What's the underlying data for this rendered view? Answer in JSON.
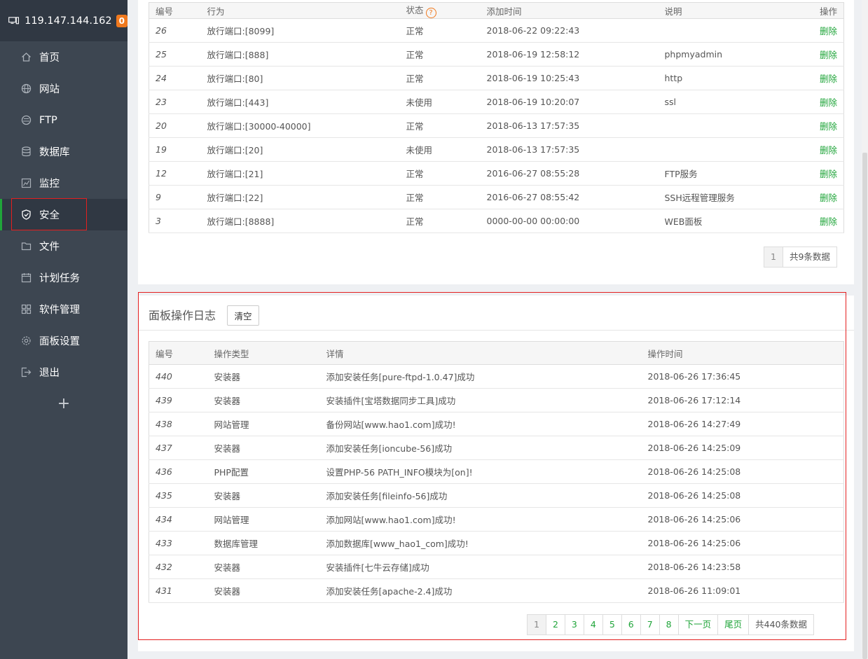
{
  "sidebar": {
    "ip": "119.147.144.162",
    "badge": "0",
    "items": [
      {
        "label": "首页",
        "icon": "home-icon"
      },
      {
        "label": "网站",
        "icon": "globe-icon"
      },
      {
        "label": "FTP",
        "icon": "ftp-icon"
      },
      {
        "label": "数据库",
        "icon": "database-icon"
      },
      {
        "label": "监控",
        "icon": "monitor-chart-icon"
      },
      {
        "label": "安全",
        "icon": "shield-icon"
      },
      {
        "label": "文件",
        "icon": "folder-icon"
      },
      {
        "label": "计划任务",
        "icon": "calendar-icon"
      },
      {
        "label": "软件管理",
        "icon": "grid-icon"
      },
      {
        "label": "面板设置",
        "icon": "gear-icon"
      },
      {
        "label": "退出",
        "icon": "logout-icon"
      }
    ],
    "plus": "+"
  },
  "firewall": {
    "headers": {
      "id": "编号",
      "action": "行为",
      "status": "状态",
      "added": "添加时间",
      "note": "说明",
      "op": "操作"
    },
    "help": "?",
    "rows": [
      {
        "id": "26",
        "action": "放行端口:[8099]",
        "status": "正常",
        "added": "2018-06-22 09:22:43",
        "note": "",
        "op": "删除"
      },
      {
        "id": "25",
        "action": "放行端口:[888]",
        "status": "正常",
        "added": "2018-06-19 12:58:12",
        "note": "phpmyadmin",
        "op": "删除"
      },
      {
        "id": "24",
        "action": "放行端口:[80]",
        "status": "正常",
        "added": "2018-06-19 10:25:43",
        "note": "http",
        "op": "删除"
      },
      {
        "id": "23",
        "action": "放行端口:[443]",
        "status": "未使用",
        "added": "2018-06-19 10:20:07",
        "note": "ssl",
        "op": "删除"
      },
      {
        "id": "20",
        "action": "放行端口:[30000-40000]",
        "status": "正常",
        "added": "2018-06-13 17:57:35",
        "note": "",
        "op": "删除"
      },
      {
        "id": "19",
        "action": "放行端口:[20]",
        "status": "未使用",
        "added": "2018-06-13 17:57:35",
        "note": "",
        "op": "删除"
      },
      {
        "id": "12",
        "action": "放行端口:[21]",
        "status": "正常",
        "added": "2016-06-27 08:55:28",
        "note": "FTP服务",
        "op": "删除"
      },
      {
        "id": "9",
        "action": "放行端口:[22]",
        "status": "正常",
        "added": "2016-06-27 08:55:42",
        "note": "SSH远程管理服务",
        "op": "删除"
      },
      {
        "id": "3",
        "action": "放行端口:[8888]",
        "status": "正常",
        "added": "0000-00-00 00:00:00",
        "note": "WEB面板",
        "op": "删除"
      }
    ],
    "pager": {
      "current": "1",
      "total": "共9条数据"
    }
  },
  "logs": {
    "title": "面板操作日志",
    "clear": "清空",
    "headers": {
      "id": "编号",
      "type": "操作类型",
      "detail": "详情",
      "time": "操作时间"
    },
    "rows": [
      {
        "id": "440",
        "type": "安装器",
        "detail": "添加安装任务[pure-ftpd-1.0.47]成功",
        "time": "2018-06-26 17:36:45"
      },
      {
        "id": "439",
        "type": "安装器",
        "detail": "安装插件[宝塔数据同步工具]成功",
        "time": "2018-06-26 17:12:14"
      },
      {
        "id": "438",
        "type": "网站管理",
        "detail": "备份网站[www.hao1.com]成功!",
        "time": "2018-06-26 14:27:49"
      },
      {
        "id": "437",
        "type": "安装器",
        "detail": "添加安装任务[ioncube-56]成功",
        "time": "2018-06-26 14:25:09"
      },
      {
        "id": "436",
        "type": "PHP配置",
        "detail": "设置PHP-56 PATH_INFO模块为[on]!",
        "time": "2018-06-26 14:25:08"
      },
      {
        "id": "435",
        "type": "安装器",
        "detail": "添加安装任务[fileinfo-56]成功",
        "time": "2018-06-26 14:25:08"
      },
      {
        "id": "434",
        "type": "网站管理",
        "detail": "添加网站[www.hao1.com]成功!",
        "time": "2018-06-26 14:25:06"
      },
      {
        "id": "433",
        "type": "数据库管理",
        "detail": "添加数据库[www_hao1_com]成功!",
        "time": "2018-06-26 14:25:06"
      },
      {
        "id": "432",
        "type": "安装器",
        "detail": "安装插件[七牛云存储]成功",
        "time": "2018-06-26 14:23:58"
      },
      {
        "id": "431",
        "type": "安装器",
        "detail": "添加安装任务[apache-2.4]成功",
        "time": "2018-06-26 11:09:01"
      }
    ],
    "pager": {
      "current": "1",
      "pages": [
        "2",
        "3",
        "4",
        "5",
        "6",
        "7",
        "8"
      ],
      "next": "下一页",
      "last": "尾页",
      "total": "共440条数据"
    }
  },
  "colors": {
    "accent": "#20a53a",
    "badge": "#f0791e",
    "highlight": "#e41f1f",
    "sidebar": "#3d4651"
  }
}
